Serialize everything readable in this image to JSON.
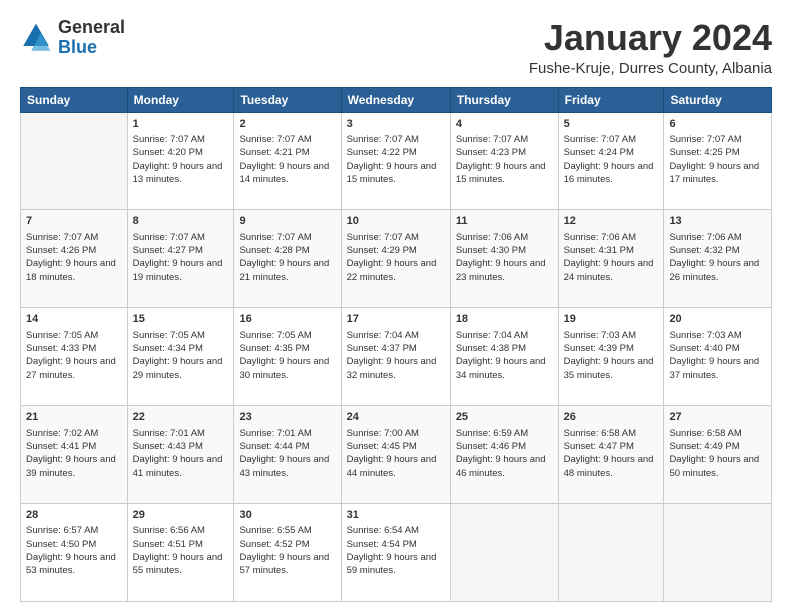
{
  "logo": {
    "general": "General",
    "blue": "Blue"
  },
  "header": {
    "title": "January 2024",
    "location": "Fushe-Kruje, Durres County, Albania"
  },
  "days": [
    "Sunday",
    "Monday",
    "Tuesday",
    "Wednesday",
    "Thursday",
    "Friday",
    "Saturday"
  ],
  "weeks": [
    [
      {
        "day": "",
        "sunrise": "",
        "sunset": "",
        "daylight": ""
      },
      {
        "day": "1",
        "sunrise": "Sunrise: 7:07 AM",
        "sunset": "Sunset: 4:20 PM",
        "daylight": "Daylight: 9 hours and 13 minutes."
      },
      {
        "day": "2",
        "sunrise": "Sunrise: 7:07 AM",
        "sunset": "Sunset: 4:21 PM",
        "daylight": "Daylight: 9 hours and 14 minutes."
      },
      {
        "day": "3",
        "sunrise": "Sunrise: 7:07 AM",
        "sunset": "Sunset: 4:22 PM",
        "daylight": "Daylight: 9 hours and 15 minutes."
      },
      {
        "day": "4",
        "sunrise": "Sunrise: 7:07 AM",
        "sunset": "Sunset: 4:23 PM",
        "daylight": "Daylight: 9 hours and 15 minutes."
      },
      {
        "day": "5",
        "sunrise": "Sunrise: 7:07 AM",
        "sunset": "Sunset: 4:24 PM",
        "daylight": "Daylight: 9 hours and 16 minutes."
      },
      {
        "day": "6",
        "sunrise": "Sunrise: 7:07 AM",
        "sunset": "Sunset: 4:25 PM",
        "daylight": "Daylight: 9 hours and 17 minutes."
      }
    ],
    [
      {
        "day": "7",
        "sunrise": "Sunrise: 7:07 AM",
        "sunset": "Sunset: 4:26 PM",
        "daylight": "Daylight: 9 hours and 18 minutes."
      },
      {
        "day": "8",
        "sunrise": "Sunrise: 7:07 AM",
        "sunset": "Sunset: 4:27 PM",
        "daylight": "Daylight: 9 hours and 19 minutes."
      },
      {
        "day": "9",
        "sunrise": "Sunrise: 7:07 AM",
        "sunset": "Sunset: 4:28 PM",
        "daylight": "Daylight: 9 hours and 21 minutes."
      },
      {
        "day": "10",
        "sunrise": "Sunrise: 7:07 AM",
        "sunset": "Sunset: 4:29 PM",
        "daylight": "Daylight: 9 hours and 22 minutes."
      },
      {
        "day": "11",
        "sunrise": "Sunrise: 7:06 AM",
        "sunset": "Sunset: 4:30 PM",
        "daylight": "Daylight: 9 hours and 23 minutes."
      },
      {
        "day": "12",
        "sunrise": "Sunrise: 7:06 AM",
        "sunset": "Sunset: 4:31 PM",
        "daylight": "Daylight: 9 hours and 24 minutes."
      },
      {
        "day": "13",
        "sunrise": "Sunrise: 7:06 AM",
        "sunset": "Sunset: 4:32 PM",
        "daylight": "Daylight: 9 hours and 26 minutes."
      }
    ],
    [
      {
        "day": "14",
        "sunrise": "Sunrise: 7:05 AM",
        "sunset": "Sunset: 4:33 PM",
        "daylight": "Daylight: 9 hours and 27 minutes."
      },
      {
        "day": "15",
        "sunrise": "Sunrise: 7:05 AM",
        "sunset": "Sunset: 4:34 PM",
        "daylight": "Daylight: 9 hours and 29 minutes."
      },
      {
        "day": "16",
        "sunrise": "Sunrise: 7:05 AM",
        "sunset": "Sunset: 4:35 PM",
        "daylight": "Daylight: 9 hours and 30 minutes."
      },
      {
        "day": "17",
        "sunrise": "Sunrise: 7:04 AM",
        "sunset": "Sunset: 4:37 PM",
        "daylight": "Daylight: 9 hours and 32 minutes."
      },
      {
        "day": "18",
        "sunrise": "Sunrise: 7:04 AM",
        "sunset": "Sunset: 4:38 PM",
        "daylight": "Daylight: 9 hours and 34 minutes."
      },
      {
        "day": "19",
        "sunrise": "Sunrise: 7:03 AM",
        "sunset": "Sunset: 4:39 PM",
        "daylight": "Daylight: 9 hours and 35 minutes."
      },
      {
        "day": "20",
        "sunrise": "Sunrise: 7:03 AM",
        "sunset": "Sunset: 4:40 PM",
        "daylight": "Daylight: 9 hours and 37 minutes."
      }
    ],
    [
      {
        "day": "21",
        "sunrise": "Sunrise: 7:02 AM",
        "sunset": "Sunset: 4:41 PM",
        "daylight": "Daylight: 9 hours and 39 minutes."
      },
      {
        "day": "22",
        "sunrise": "Sunrise: 7:01 AM",
        "sunset": "Sunset: 4:43 PM",
        "daylight": "Daylight: 9 hours and 41 minutes."
      },
      {
        "day": "23",
        "sunrise": "Sunrise: 7:01 AM",
        "sunset": "Sunset: 4:44 PM",
        "daylight": "Daylight: 9 hours and 43 minutes."
      },
      {
        "day": "24",
        "sunrise": "Sunrise: 7:00 AM",
        "sunset": "Sunset: 4:45 PM",
        "daylight": "Daylight: 9 hours and 44 minutes."
      },
      {
        "day": "25",
        "sunrise": "Sunrise: 6:59 AM",
        "sunset": "Sunset: 4:46 PM",
        "daylight": "Daylight: 9 hours and 46 minutes."
      },
      {
        "day": "26",
        "sunrise": "Sunrise: 6:58 AM",
        "sunset": "Sunset: 4:47 PM",
        "daylight": "Daylight: 9 hours and 48 minutes."
      },
      {
        "day": "27",
        "sunrise": "Sunrise: 6:58 AM",
        "sunset": "Sunset: 4:49 PM",
        "daylight": "Daylight: 9 hours and 50 minutes."
      }
    ],
    [
      {
        "day": "28",
        "sunrise": "Sunrise: 6:57 AM",
        "sunset": "Sunset: 4:50 PM",
        "daylight": "Daylight: 9 hours and 53 minutes."
      },
      {
        "day": "29",
        "sunrise": "Sunrise: 6:56 AM",
        "sunset": "Sunset: 4:51 PM",
        "daylight": "Daylight: 9 hours and 55 minutes."
      },
      {
        "day": "30",
        "sunrise": "Sunrise: 6:55 AM",
        "sunset": "Sunset: 4:52 PM",
        "daylight": "Daylight: 9 hours and 57 minutes."
      },
      {
        "day": "31",
        "sunrise": "Sunrise: 6:54 AM",
        "sunset": "Sunset: 4:54 PM",
        "daylight": "Daylight: 9 hours and 59 minutes."
      },
      {
        "day": "",
        "sunrise": "",
        "sunset": "",
        "daylight": ""
      },
      {
        "day": "",
        "sunrise": "",
        "sunset": "",
        "daylight": ""
      },
      {
        "day": "",
        "sunrise": "",
        "sunset": "",
        "daylight": ""
      }
    ]
  ]
}
